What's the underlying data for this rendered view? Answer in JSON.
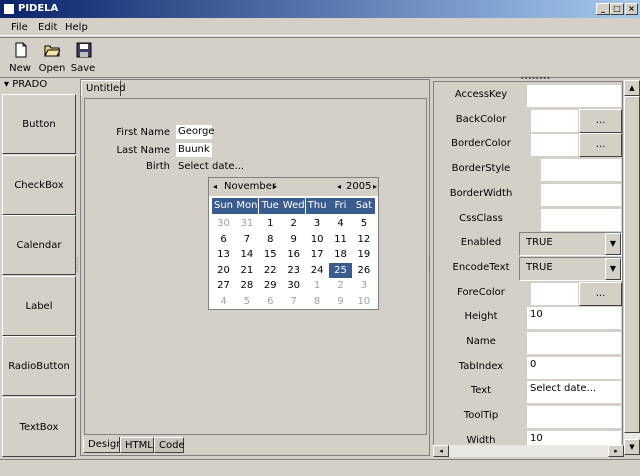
{
  "window": {
    "title": "PIDELA",
    "min": "_",
    "max": "□",
    "close": "×"
  },
  "menu": [
    "File",
    "Edit",
    "Help"
  ],
  "toolbar": {
    "new": "New",
    "open": "Open",
    "save": "Save"
  },
  "palette": {
    "title": "PRADO",
    "items": [
      "Button",
      "CheckBox",
      "Calendar",
      "Label",
      "RadioButton",
      "TextBox"
    ]
  },
  "doc_tab": "Untitled",
  "form": {
    "first_name_label": "First Name",
    "first_name": "George",
    "last_name_label": "Last Name",
    "last_name": "Buunk",
    "birth_label": "Birth",
    "birth_value": "Select date..."
  },
  "calendar": {
    "month": "November",
    "year": "2005",
    "days": [
      "Sun",
      "Mon",
      "Tue",
      "Wed",
      "Thu",
      "Fri",
      "Sat"
    ],
    "weeks": [
      [
        "30",
        "31",
        "1",
        "2",
        "3",
        "4",
        "5"
      ],
      [
        "6",
        "7",
        "8",
        "9",
        "10",
        "11",
        "12"
      ],
      [
        "13",
        "14",
        "15",
        "16",
        "17",
        "18",
        "19"
      ],
      [
        "20",
        "21",
        "22",
        "23",
        "24",
        "25",
        "26"
      ],
      [
        "27",
        "28",
        "29",
        "30",
        "1",
        "2",
        "3"
      ],
      [
        "4",
        "5",
        "6",
        "7",
        "8",
        "9",
        "10"
      ]
    ],
    "selected": "25"
  },
  "bottom_tabs": [
    "Design",
    "HTML",
    "Code"
  ],
  "properties": [
    {
      "name": "AccessKey",
      "value": "",
      "kind": "text"
    },
    {
      "name": "BackColor",
      "value": "",
      "kind": "dots",
      "button": "..."
    },
    {
      "name": "BorderColor",
      "value": "",
      "kind": "dots",
      "button": "..."
    },
    {
      "name": "BorderStyle",
      "value": "",
      "kind": "text"
    },
    {
      "name": "BorderWidth",
      "value": "",
      "kind": "text"
    },
    {
      "name": "CssClass",
      "value": "",
      "kind": "text"
    },
    {
      "name": "Enabled",
      "value": "TRUE",
      "kind": "select"
    },
    {
      "name": "EncodeText",
      "value": "TRUE",
      "kind": "select"
    },
    {
      "name": "ForeColor",
      "value": "",
      "kind": "dots",
      "button": "..."
    },
    {
      "name": "Height",
      "value": "10",
      "kind": "text"
    },
    {
      "name": "Name",
      "value": "",
      "kind": "text"
    },
    {
      "name": "TabIndex",
      "value": "0",
      "kind": "text"
    },
    {
      "name": "Text",
      "value": "Select date...",
      "kind": "text"
    },
    {
      "name": "ToolTip",
      "value": "",
      "kind": "text"
    },
    {
      "name": "Width",
      "value": "10",
      "kind": "text"
    }
  ]
}
